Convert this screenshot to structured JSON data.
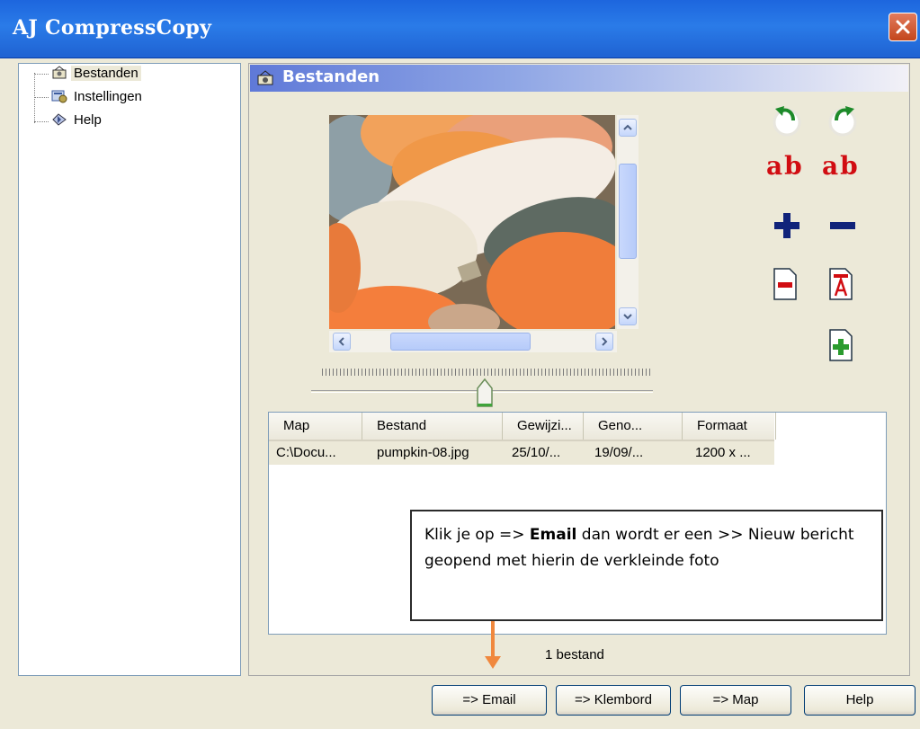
{
  "window": {
    "title": "AJ CompressCopy"
  },
  "tree": {
    "items": [
      {
        "label": "Bestanden",
        "icon": "files-icon",
        "selected": true
      },
      {
        "label": "Instellingen",
        "icon": "settings-icon",
        "selected": false
      },
      {
        "label": "Help",
        "icon": "help-icon",
        "selected": false
      }
    ]
  },
  "panel": {
    "title": "Bestanden"
  },
  "preview": {
    "image": "pumpkin-photo"
  },
  "tools": {
    "rotate_left": "rotate-left-icon",
    "rotate_right": "rotate-right-icon",
    "text_a": "ab",
    "text_b": "ab",
    "zoom_in": "plus-icon",
    "zoom_out": "minus-icon",
    "remove_file": "remove-file-icon",
    "rename_file": "rename-file-icon",
    "add_file": "add-file-icon"
  },
  "list": {
    "columns": [
      "Map",
      "Bestand",
      "Gewijzi...",
      "Geno...",
      "Formaat"
    ],
    "rows": [
      [
        "C:\\Docu...",
        "pumpkin-08.jpg",
        "25/10/...",
        "19/09/...",
        "1200 x ..."
      ]
    ]
  },
  "callout": {
    "before": "Klik je op => ",
    "bold": "Email",
    "after": " dan wordt er een >> Nieuw bericht geopend met hierin de verkleinde foto"
  },
  "status": "1 bestand",
  "buttons": {
    "email": "=> Email",
    "klembord": "=> Klembord",
    "map": "=> Map",
    "help": "Help"
  },
  "colors": {
    "titlebar": "#2a7be8",
    "accent_text": "#d10d12",
    "arrow": "#f0883e",
    "close": "#c3461c"
  }
}
